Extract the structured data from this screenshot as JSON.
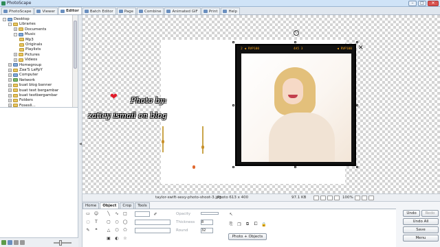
{
  "window": {
    "title": "PhotoScape"
  },
  "tabs": [
    {
      "label": "PhotoScape",
      "icon": "photoscape-icon"
    },
    {
      "label": "Viewer",
      "icon": "viewer-icon"
    },
    {
      "label": "Editor",
      "icon": "editor-icon"
    },
    {
      "label": "Batch Editor",
      "icon": "batch-editor-icon"
    },
    {
      "label": "Page",
      "icon": "page-icon"
    },
    {
      "label": "Combine",
      "icon": "combine-icon"
    },
    {
      "label": "Animated GIF",
      "icon": "animated-gif-icon"
    },
    {
      "label": "Print",
      "icon": "print-icon"
    },
    {
      "label": "Help",
      "icon": "help-icon"
    }
  ],
  "active_tab": "Editor",
  "tree": [
    {
      "label": "Desktop",
      "level": 0,
      "expander": "-",
      "folder": "blue"
    },
    {
      "label": "Libraries",
      "level": 1,
      "expander": "-",
      "folder": "yellow"
    },
    {
      "label": "Documents",
      "level": 2,
      "expander": "+",
      "folder": "yellow"
    },
    {
      "label": "Music",
      "level": 2,
      "expander": "-",
      "folder": "blue"
    },
    {
      "label": "Mp3",
      "level": 3,
      "expander": "",
      "folder": "yellow"
    },
    {
      "label": "Originals",
      "level": 3,
      "expander": "",
      "folder": "yellow"
    },
    {
      "label": "Playlists",
      "level": 3,
      "expander": "",
      "folder": "yellow"
    },
    {
      "label": "Pictures",
      "level": 2,
      "expander": "+",
      "folder": "yellow"
    },
    {
      "label": "Videos",
      "level": 2,
      "expander": "+",
      "folder": "yellow"
    },
    {
      "label": "Homegroup",
      "level": 1,
      "expander": "+",
      "folder": "blue"
    },
    {
      "label": "Zaa'S LaPpY",
      "level": 1,
      "expander": "+",
      "folder": "yellow"
    },
    {
      "label": "Computer",
      "level": 1,
      "expander": "+",
      "folder": "blue"
    },
    {
      "label": "Network",
      "level": 1,
      "expander": "+",
      "folder": "green"
    },
    {
      "label": "buat blog banner",
      "level": 1,
      "expander": "+",
      "folder": "yellow"
    },
    {
      "label": "buat text bergambar",
      "level": 1,
      "expander": "+",
      "folder": "yellow"
    },
    {
      "label": "buat textbergambar",
      "level": 1,
      "expander": "+",
      "folder": "yellow"
    },
    {
      "label": "Folders",
      "level": 1,
      "expander": "+",
      "folder": "yellow"
    },
    {
      "label": "Fosesli...",
      "level": 1,
      "expander": "+",
      "folder": "yellow"
    }
  ],
  "canvas": {
    "deco_line1": "Photo by:",
    "deco_line2": "zatiey ismail on blog",
    "frame_counter_left": "2 ◀ RVP100",
    "frame_counter_mid": "4A5  3",
    "frame_counter_right": "◀ RVP100"
  },
  "status": {
    "filename": "taylor-swift-sexy-photo-shoot-3.jpg",
    "dimensions": "Photo 613 x 400",
    "filesize": "97.1 KB",
    "zoom": "100%"
  },
  "toolbox": {
    "tabs": [
      "Home",
      "Object",
      "Crop",
      "Tools"
    ],
    "active_tab": "Object",
    "opacity_label": "Opacity",
    "thickness_label": "Thickness",
    "thickness_value": "8",
    "round_label": "Round",
    "round_value": "32",
    "photo_objects_label": "Photo + Objects"
  },
  "buttons": {
    "undo": "Undo",
    "redo": "Redo",
    "undo_all": "Undo All",
    "save": "Save",
    "menu": "Menu"
  },
  "colors": {
    "accent_tab": "#6a8fbf",
    "heart": "#e21b2a",
    "frame_text": "#f2a11c"
  }
}
